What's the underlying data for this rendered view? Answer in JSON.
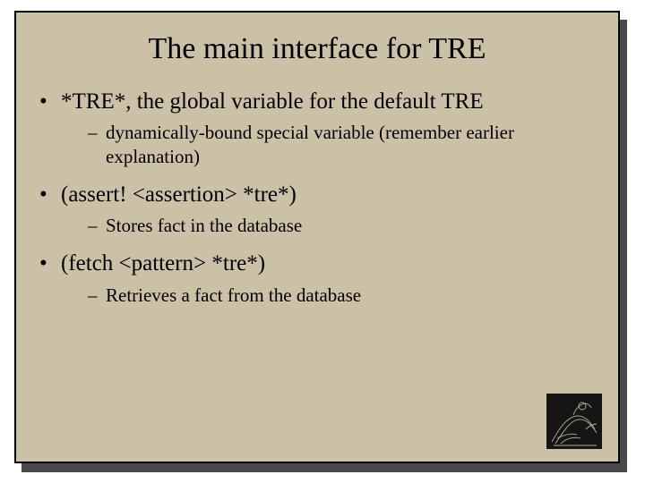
{
  "title": "The main interface for TRE",
  "bullets": [
    {
      "text": "*TRE*, the global variable for the default TRE",
      "sub": [
        "dynamically-bound special variable (remember earlier explanation)"
      ]
    },
    {
      "text": "(assert! <assertion> *tre*)",
      "sub": [
        "Stores fact in the database"
      ]
    },
    {
      "text": "(fetch <pattern> *tre*)",
      "sub": [
        "Retrieves a fact from the database"
      ]
    }
  ],
  "logo_name": "shadowy-figure-emblem"
}
